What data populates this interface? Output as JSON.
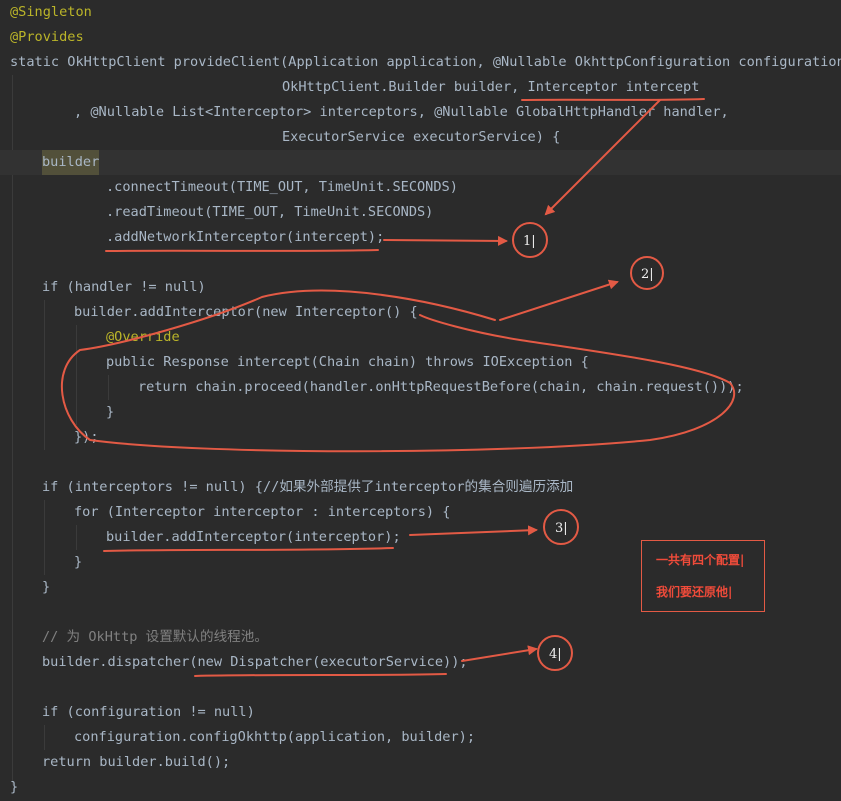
{
  "code": {
    "l1": "@Singleton",
    "l2": "@Provides",
    "l3": "static OkHttpClient provideClient(Application application, @Nullable OkhttpConfiguration configuration,",
    "l4": "OkHttpClient.Builder builder, Interceptor intercept",
    "l5": ", @Nullable List<Interceptor> interceptors, @Nullable GlobalHttpHandler handler,",
    "l6": "ExecutorService executorService) {",
    "l7": "builder",
    "l8": ".connectTimeout(TIME_OUT, TimeUnit.SECONDS)",
    "l9": ".readTimeout(TIME_OUT, TimeUnit.SECONDS)",
    "l10": ".addNetworkInterceptor(intercept);",
    "l12": "if (handler != null)",
    "l13": "builder.addInterceptor(new Interceptor() {",
    "l14": "@Override",
    "l15": "public Response intercept(Chain chain) throws IOException {",
    "l16": "return chain.proceed(handler.onHttpRequestBefore(chain, chain.request()));",
    "l17": "}",
    "l18": "});",
    "l20": "if (interceptors != null) {//如果外部提供了interceptor的集合则遍历添加",
    "l21": "for (Interceptor interceptor : interceptors) {",
    "l22": "builder.addInterceptor(interceptor);",
    "l23": "}",
    "l24": "}",
    "l26": "// 为 OkHttp 设置默认的线程池。",
    "l27": "builder.dispatcher(new Dispatcher(executorService));",
    "l29": "if (configuration != null)",
    "l30": "configuration.configOkhttp(application, builder);",
    "l31": "return builder.build();",
    "l32": "}"
  },
  "annotations": {
    "markers": [
      "1|",
      "2|",
      "3|",
      "4|"
    ],
    "note_line1": "一共有四个配置|",
    "note_line2": "我们要还原他|"
  },
  "colors": {
    "background": "#2b2b2b",
    "annotation_red": "#e35a45"
  }
}
